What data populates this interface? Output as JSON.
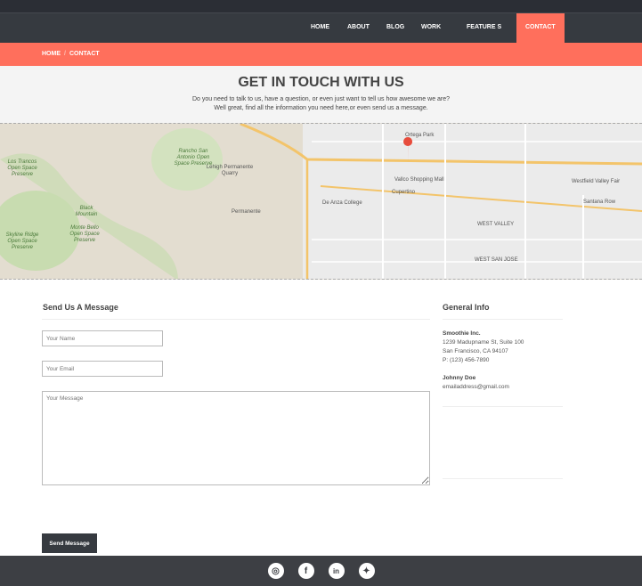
{
  "nav": {
    "items": [
      "HOME",
      "ABOUT",
      "BLOG",
      "WORK",
      "FEATURE S",
      "CONTACT"
    ],
    "active": "CONTACT"
  },
  "breadcrumb": {
    "home": "HOME",
    "sep": "/",
    "current": "CONTACT"
  },
  "hero": {
    "title": "GET IN TOUCH WITH US",
    "line1": "Do you need to talk to us, have a question, or even just want to tell us how awesome we are?",
    "line2": "Well great, find all the information you need here,or even send us a message."
  },
  "map": {
    "labels": [
      "Ortega Park",
      "Vallco Shopping Mall",
      "Cupertino",
      "De Anza College",
      "Lehigh Permanente Quarry",
      "Permanente",
      "Rancho San Antonio Open Space Preserve",
      "Los Trancos Open Space Preserve",
      "Black Mountain",
      "Monte Bello Open Space Preserve",
      "Skyline Ridge Open Space Preserve",
      "Westfield Valley Fair",
      "Santana Row",
      "WEST VALLEY",
      "WEST SAN JOSE"
    ]
  },
  "form": {
    "title": "Send Us A Message",
    "name_placeholder": "Your Name",
    "email_placeholder": "Your Email",
    "message_placeholder": "Your Message",
    "submit": "Send Message"
  },
  "info": {
    "title": "General Info",
    "company": "Smoothie Inc.",
    "address1": "1239 Madupname St, Suite 100",
    "address2": "San Francisco, CA 94107",
    "phone": "P: (123) 456-7890",
    "person": "Johnny Doe",
    "email": "emailaddress@gmail.com"
  },
  "social": [
    "instagram",
    "facebook",
    "linkedin",
    "twitter"
  ],
  "colors": {
    "accent": "#ff6f5c",
    "dark": "#363a40"
  }
}
